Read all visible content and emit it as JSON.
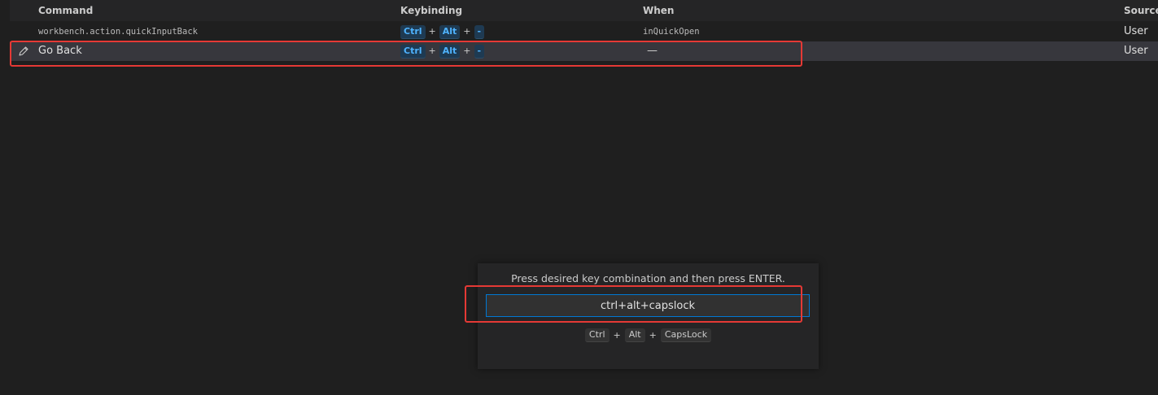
{
  "header": {
    "command": "Command",
    "keybinding": "Keybinding",
    "when": "When",
    "source": "Source"
  },
  "rows": [
    {
      "command": "workbench.action.quickInputBack",
      "keys": [
        "Ctrl",
        "Alt",
        "-"
      ],
      "when": "inQuickOpen",
      "source": "User"
    },
    {
      "command": "Go Back",
      "keys": [
        "Ctrl",
        "Alt",
        "-"
      ],
      "when": "—",
      "source": "User",
      "icon": "pencil-edit-icon"
    }
  ],
  "dialog": {
    "message": "Press desired key combination and then press ENTER.",
    "input_value": "ctrl+alt+capslock",
    "keys": [
      "Ctrl",
      "Alt",
      "CapsLock"
    ]
  },
  "plus": "+",
  "colors": {
    "background": "#1f1f1f",
    "selected_row": "#37373d",
    "key_chip_bg": "#1e3a52",
    "key_chip_fg": "#4fb3ff",
    "focus_border": "#0078d4",
    "highlight": "#e53935"
  }
}
